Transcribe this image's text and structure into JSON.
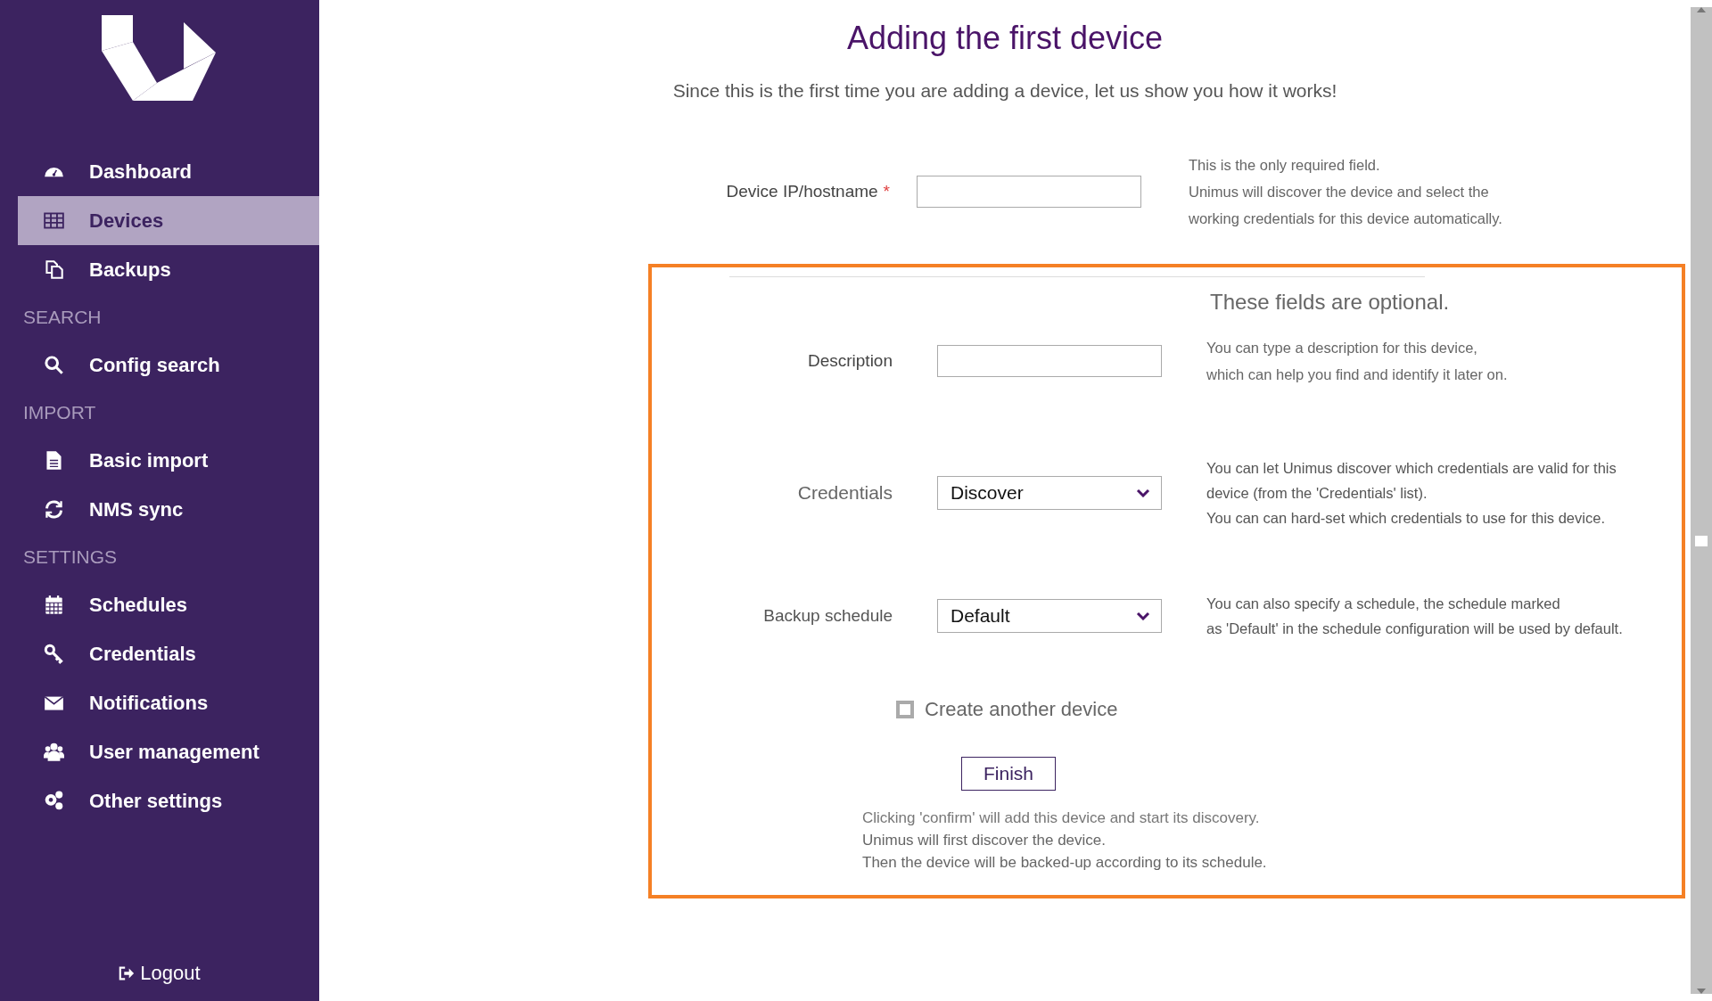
{
  "sidebar": {
    "items": [
      {
        "kind": "item",
        "label": "Dashboard",
        "selected": false
      },
      {
        "kind": "item",
        "label": "Devices",
        "selected": true
      },
      {
        "kind": "item",
        "label": "Backups",
        "selected": false
      },
      {
        "kind": "section",
        "label": "SEARCH"
      },
      {
        "kind": "item",
        "label": "Config search",
        "selected": false
      },
      {
        "kind": "section",
        "label": "IMPORT"
      },
      {
        "kind": "item",
        "label": "Basic import",
        "selected": false
      },
      {
        "kind": "item",
        "label": "NMS sync",
        "selected": false
      },
      {
        "kind": "section",
        "label": "SETTINGS"
      },
      {
        "kind": "item",
        "label": "Schedules",
        "selected": false
      },
      {
        "kind": "item",
        "label": "Credentials",
        "selected": false
      },
      {
        "kind": "item",
        "label": "Notifications",
        "selected": false
      },
      {
        "kind": "item",
        "label": "User management",
        "selected": false
      },
      {
        "kind": "item",
        "label": "Other settings",
        "selected": false
      }
    ],
    "logout": "Logout"
  },
  "title": "Adding the first device",
  "subtitle": "Since this is the first time you are adding a device, let us show you how it works!",
  "required_field": {
    "label": "Device IP/hostname",
    "required_mark": "*",
    "help": [
      "This is the only required field.",
      "Unimus will discover the device and select the",
      "working credentials for this device automatically."
    ]
  },
  "optional": {
    "heading": "These fields are optional.",
    "fields": [
      {
        "kind": "text",
        "label": "Description",
        "help": [
          "You can type a description for this device,",
          "which can help you find and identify it later on."
        ]
      },
      {
        "kind": "select",
        "label": "Credentials",
        "value": "Discover",
        "help": [
          "You can let Unimus discover which credentials are valid for this",
          "device (from the 'Credentials' list).",
          "You can can hard-set which credentials to use for this device."
        ]
      },
      {
        "kind": "select",
        "label": "Backup schedule",
        "value": "Default",
        "help": [
          "You can also specify a schedule, the schedule marked",
          "as 'Default' in the schedule configuration will be used by default."
        ]
      }
    ],
    "checkbox": {
      "label": "Create another device",
      "checked": false
    },
    "button": "Finish",
    "notes": [
      "Clicking 'confirm' will add this device and start its discovery.",
      "Unimus will first discover the device.",
      "Then the device will be backed-up according to its schedule."
    ]
  }
}
